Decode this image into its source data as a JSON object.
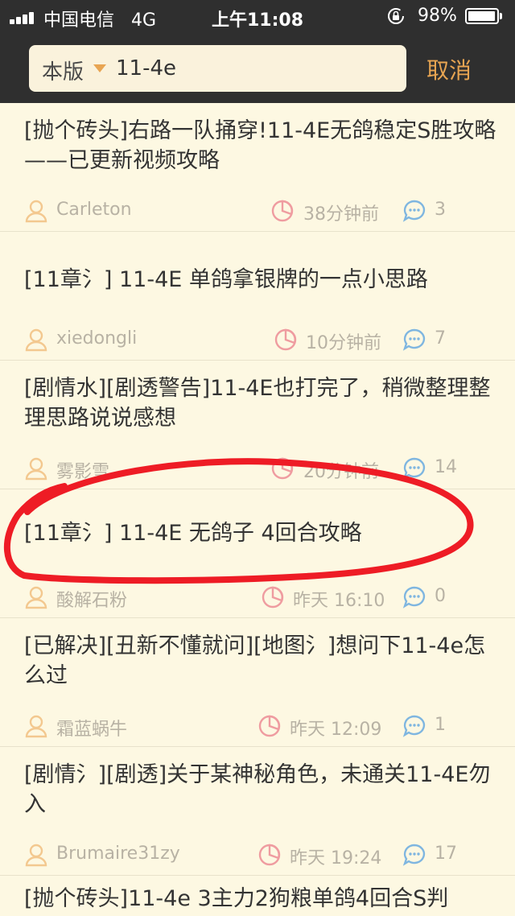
{
  "status": {
    "carrier": "中国电信",
    "network": "4G",
    "time": "上午11:08",
    "battery": "98%",
    "battery_level": 0.98
  },
  "search": {
    "scope": "本版",
    "query": "11-4e",
    "cancel_label": "取消"
  },
  "posts": [
    {
      "title": "[抛个砖头]右路一队捅穿!11-4E无鸽稳定S胜攻略——已更新视频攻略",
      "author": "Carleton",
      "time": "38分钟前",
      "comments": "3"
    },
    {
      "title": "[11章氵] 11-4E 单鸽拿银牌的一点小思路",
      "author": "xiedongli",
      "time": "10分钟前",
      "comments": "7"
    },
    {
      "title": "[剧情水][剧透警告]11-4E也打完了，稍微整理整理思路说说感想",
      "author": "雾影雪",
      "time": "20分钟前",
      "comments": "14"
    },
    {
      "title": "[11章氵] 11-4E 无鸽子 4回合攻略",
      "author": "酸解石粉",
      "time": "昨天 16:10",
      "comments": "0"
    },
    {
      "title": "[已解决][丑新不懂就问][地图氵]想问下11-4e怎么过",
      "author": "霜蓝蜗牛",
      "time": "昨天 12:09",
      "comments": "1"
    },
    {
      "title": "[剧情氵][剧透]关于某神秘角色，未通关11-4E勿入",
      "author": "Brumaire31zy",
      "time": "昨天 19:24",
      "comments": "17"
    },
    {
      "title": "[抛个砖头]11-4e 3主力2狗粮单鸽4回合S判"
    }
  ],
  "colors": {
    "accent": "#e8a552",
    "highlight": "#ee1c25",
    "meta": "#b8b2a4",
    "background": "#fdf8e2",
    "bar": "#2f2f2f"
  },
  "icons": [
    "signal-icon",
    "lock-rotation-icon",
    "battery-icon",
    "dropdown-arrow-icon",
    "user-icon",
    "clock-icon",
    "comment-icon"
  ]
}
